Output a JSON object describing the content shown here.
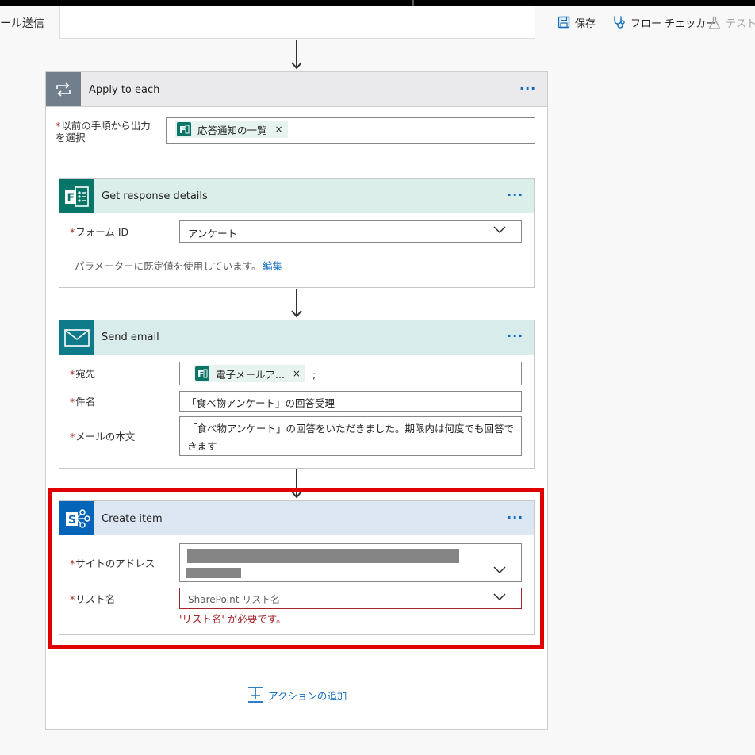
{
  "header": {
    "title": "ール送信",
    "save_label": "保存",
    "checker_label": "フロー チェッカー",
    "test_label": "テスト"
  },
  "apply_to_each": {
    "title": "Apply to each",
    "select_label": "以前の手順から出力を選択",
    "token_label": "応答通知の一覧",
    "token_x": "×"
  },
  "get_response": {
    "title": "Get response details",
    "form_id_label": "フォーム ID",
    "form_id_value": "アンケート",
    "default_note": "パラメーターに既定値を使用しています。",
    "edit_link": "編集"
  },
  "send_email": {
    "title": "Send email",
    "to_label": "宛先",
    "to_token": "電子メールア...",
    "to_token_x": "×",
    "to_suffix": ";",
    "subject_label": "件名",
    "subject_value": "「食べ物アンケート」の回答受理",
    "body_label": "メールの本文",
    "body_value": "「食べ物アンケート」の回答をいただきました。期限内は何度でも回答できます"
  },
  "create_item": {
    "title": "Create item",
    "site_label": "サイトのアドレス",
    "list_label": "リスト名",
    "list_placeholder": "SharePoint リスト名",
    "error_text": "'リスト名' が必要です。"
  },
  "add_action": {
    "label": "アクションの追加"
  },
  "required_mark": "*",
  "more_dots": "···",
  "colors": {
    "accent": "#0f6cbd",
    "forms_green": "#077568",
    "outlook_teal": "#0e7a8a",
    "sharepoint_blue": "#0364b8",
    "apply_gray": "#717e8c",
    "error_red": "#a4262c",
    "highlight_red": "#e00000"
  }
}
